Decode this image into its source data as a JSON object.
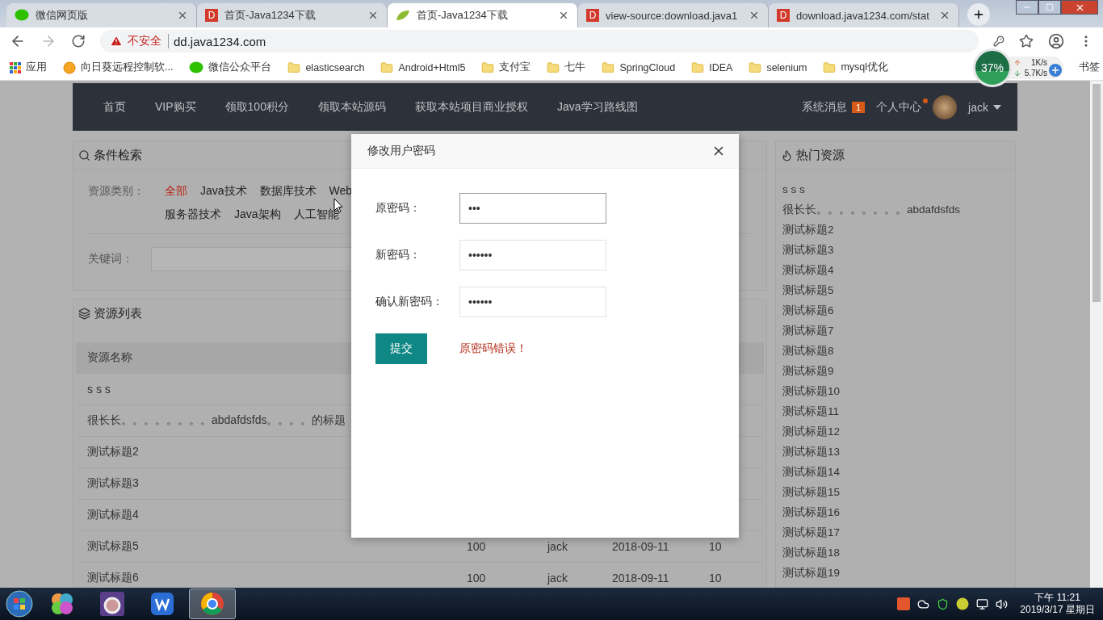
{
  "browser": {
    "tabs": [
      {
        "title": "微信网页版",
        "kind": "wechat",
        "selected": false
      },
      {
        "title": "首页-Java1234下载",
        "kind": "letter",
        "letter": "D",
        "selected": false
      },
      {
        "title": "首页-Java1234下载",
        "kind": "leaf",
        "selected": true
      },
      {
        "title": "view-source:download.java1",
        "kind": "letter",
        "letter": "D",
        "selected": false
      },
      {
        "title": "download.java1234.com/stat",
        "kind": "letter",
        "letter": "D",
        "selected": false
      }
    ],
    "address": {
      "warning": "不安全",
      "url": "dd.java1234.com"
    },
    "bookmarks": [
      {
        "label": "应用",
        "kind": "apps"
      },
      {
        "label": "向日葵远程控制软...",
        "kind": "sun"
      },
      {
        "label": "微信公众平台",
        "kind": "wechat"
      },
      {
        "label": "elasticsearch",
        "kind": "folder"
      },
      {
        "label": "Android+Html5",
        "kind": "folder"
      },
      {
        "label": "支付宝",
        "kind": "folder"
      },
      {
        "label": "七牛",
        "kind": "folder"
      },
      {
        "label": "SpringCloud",
        "kind": "folder"
      },
      {
        "label": "IDEA",
        "kind": "folder"
      },
      {
        "label": "selenium",
        "kind": "folder"
      },
      {
        "label": "mysql优化",
        "kind": "folder"
      }
    ],
    "bookmarks_right": "书签"
  },
  "speed_widget": {
    "percent": "37%",
    "upload": "1K/s",
    "download": "5.7K/s"
  },
  "nav": {
    "items": [
      "首页",
      "VIP购买",
      "领取100积分",
      "领取本站源码",
      "获取本站项目商业授权",
      "Java学习路线图"
    ],
    "messages": {
      "label": "系统消息",
      "count": "1"
    },
    "profile": {
      "label": "个人中心",
      "dot": true
    },
    "user": "jack"
  },
  "search_panel": {
    "title": "条件检索",
    "category_label": "资源类别：",
    "categories": [
      [
        {
          "label": "全部",
          "selected": true
        },
        {
          "label": "Java技术",
          "selected": false
        },
        {
          "label": "数据库技术",
          "selected": false
        },
        {
          "label": "Web",
          "selected": false
        }
      ],
      [
        {
          "label": "服务器技术",
          "selected": false
        },
        {
          "label": "Java架构",
          "selected": false
        },
        {
          "label": "人工智能",
          "selected": false
        }
      ]
    ],
    "keyword_label": "关键词："
  },
  "list_panel": {
    "title": "资源列表",
    "columns": [
      "资源名称"
    ],
    "rows": [
      {
        "name": "s s s"
      },
      {
        "name": "很长长。。。。。。。。abdafdsfds。。。。的标题"
      },
      {
        "name": "测试标题2"
      },
      {
        "name": "测试标题3"
      },
      {
        "name": "测试标题4"
      },
      {
        "name": "测试标题5",
        "cells": [
          "100",
          "jack",
          "2018-09-11",
          "10"
        ]
      },
      {
        "name": "测试标题6",
        "cells": [
          "100",
          "jack",
          "2018-09-11",
          "10"
        ]
      }
    ]
  },
  "hot_panel": {
    "title": "热门资源",
    "items": [
      "s s s",
      "很长长。。。。。。。。abdafdsfds",
      "测试标题2",
      "测试标题3",
      "测试标题4",
      "测试标题5",
      "测试标题6",
      "测试标题7",
      "测试标题8",
      "测试标题9",
      "测试标题10",
      "测试标题11",
      "测试标题12",
      "测试标题13",
      "测试标题14",
      "测试标题15",
      "测试标题16",
      "测试标题17",
      "测试标题18",
      "测试标题19"
    ]
  },
  "dialog": {
    "title": "修改用户密码",
    "fields": [
      {
        "label": "原密码：",
        "value": "•••",
        "focused": true
      },
      {
        "label": "新密码：",
        "value": "••••••",
        "focused": false
      },
      {
        "label": "确认新密码：",
        "value": "••••••",
        "focused": false
      }
    ],
    "submit": "提交",
    "error": "原密码错误！"
  },
  "taskbar": {
    "apps": [
      {
        "kind": "balls",
        "active": false
      },
      {
        "kind": "ide",
        "active": false
      },
      {
        "kind": "wps",
        "active": false
      },
      {
        "kind": "chrome",
        "active": true
      }
    ],
    "time": "下午 11:21",
    "date": "2019/3/17 星期日"
  }
}
